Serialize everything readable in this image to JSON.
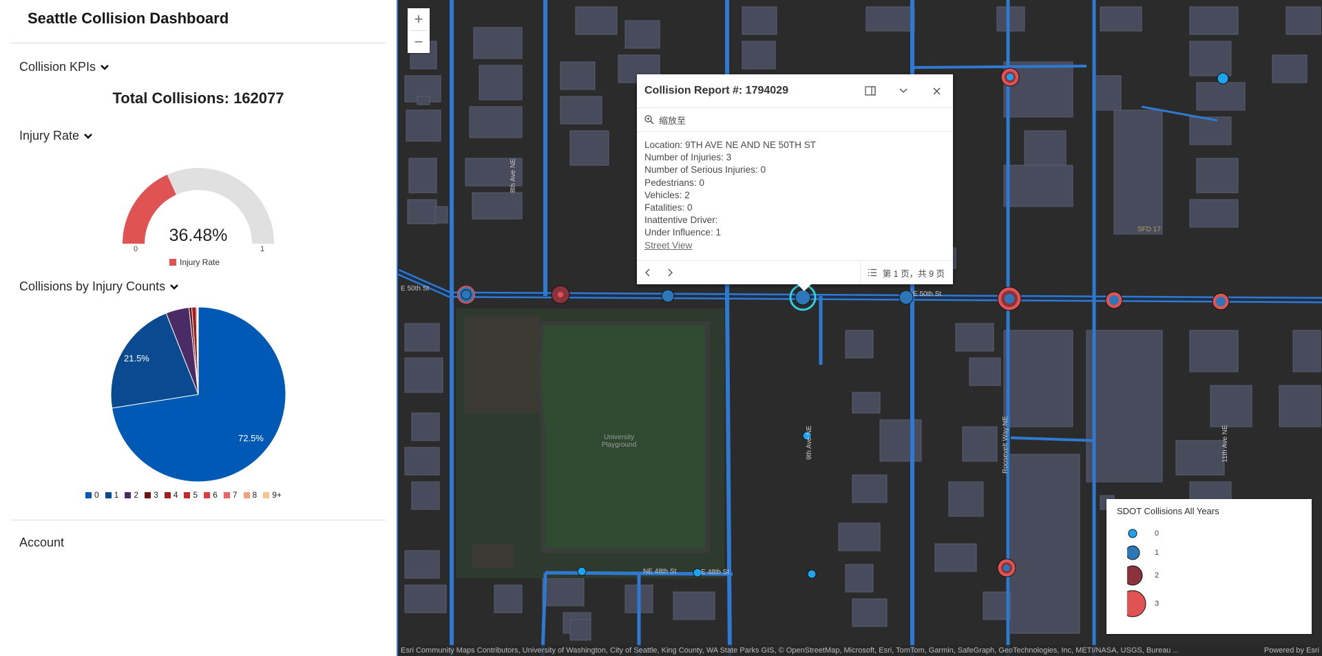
{
  "app": {
    "title": "Seattle Collision Dashboard"
  },
  "sections": {
    "kpis": "Collision KPIs",
    "injury_rate": "Injury Rate",
    "by_injury": "Collisions by Injury Counts",
    "account": "Account"
  },
  "kpi": {
    "total_text": "Total Collisions: 162077"
  },
  "gauge": {
    "value_text": "36.48%",
    "value": 0.3648,
    "min_label": "0",
    "max_label": "1",
    "legend": "Injury Rate",
    "fill_color": "#e05353",
    "track_color": "#e0e0e0"
  },
  "chart_data": {
    "type": "pie",
    "categories": [
      "0",
      "1",
      "2",
      "3",
      "4",
      "5",
      "6",
      "7",
      "8",
      "9+"
    ],
    "values": [
      72.5,
      21.5,
      4.3,
      0.5,
      0.8,
      0.2,
      0.1,
      0.05,
      0.03,
      0.02
    ],
    "data_labels": [
      "72.5%",
      "21.5%"
    ],
    "colors": [
      "#005ab5",
      "#0a4a91",
      "#4b2b66",
      "#6b1212",
      "#a31b1b",
      "#c62828",
      "#e03b3b",
      "#ee6363",
      "#f2a07d",
      "#f6c68f"
    ]
  },
  "popup": {
    "title": "Collision Report #: 1794029",
    "zoom_label": "缩放至",
    "fields": [
      "Location: 9TH AVE NE AND NE 50TH ST",
      "Number of Injuries: 3",
      "Number of Serious Injuries: 0",
      "Pedestrians: 0",
      "Vehicles: 2",
      "Fatalities: 0",
      "Inattentive Driver:",
      "Under Influence: 1"
    ],
    "link": "Street View",
    "pager": "第 1 页，共 9 页"
  },
  "map": {
    "roads": {
      "e50th_left": "E 50th St",
      "e50th_right": "E 50th St",
      "ave8": "8th Ave NE",
      "ave9": "9th Ave NE",
      "roosevelt": "Roosevelt Way NE",
      "ave11": "11th Ave NE",
      "ne48": "NE 48th St",
      "e48": "E 48th St"
    },
    "places": {
      "park": "University Playground",
      "sfd": "SFD 17"
    },
    "attribution": "Esri Community Maps Contributors, University of Washington, City of Seattle, King County, WA State Parks GIS, © OpenStreetMap, Microsoft, Esri, TomTom, Garmin, SafeGraph, GeoTechnologies, Inc, METI/NASA, USGS, Bureau ...",
    "powered": "Powered by Esri",
    "zoom_in": "+",
    "zoom_out": "−"
  },
  "legend": {
    "title": "SDOT Collisions All Years",
    "items": [
      "0",
      "1",
      "2",
      "3"
    ],
    "colors": [
      "#1ea3ee",
      "#2c77b8",
      "#8b333c",
      "#e05353"
    ]
  }
}
